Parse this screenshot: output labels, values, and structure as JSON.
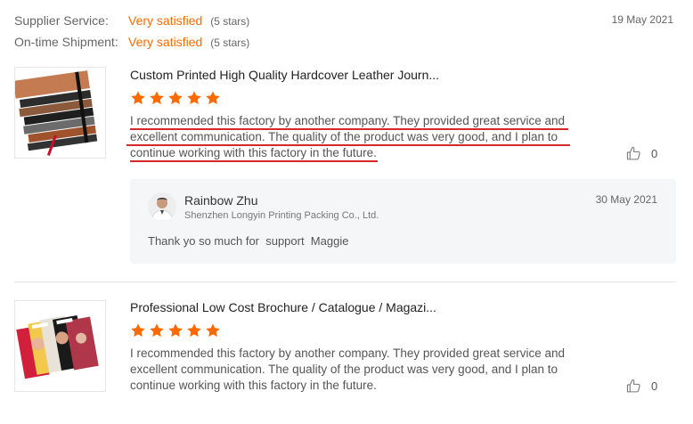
{
  "ratings": {
    "supplier_service": {
      "label": "Supplier Service:",
      "value": "Very satisfied",
      "stars_note": "(5 stars)"
    },
    "on_time_shipment": {
      "label": "On-time Shipment:",
      "value": "Very satisfied",
      "stars_note": "(5 stars)"
    },
    "date": "19 May 2021"
  },
  "reviews": [
    {
      "product_title": "Custom Printed High Quality Hardcover Leather Journ...",
      "rating": 5,
      "text_lines": [
        "I recommended this factory by another company. They provided great service and",
        "excellent communication. The quality of the product was very good, and I plan to",
        "continue working with this factory in the future."
      ],
      "likes": "0",
      "reply": {
        "name": "Rainbow Zhu",
        "company": "Shenzhen Longyin Printing Packing Co., Ltd.",
        "date": "30 May 2021",
        "text": "Thank yo so much for  support  Maggie"
      }
    },
    {
      "product_title": "Professional Low Cost Brochure / Catalogue / Magazi...",
      "rating": 5,
      "text_lines": [
        "I recommended this factory by another company. They provided great service and",
        "excellent communication. The quality of the product was very good, and I plan to",
        "continue working with this factory in the future."
      ],
      "likes": "0"
    }
  ],
  "colors": {
    "accent": "#ff6a00",
    "underline": "#d62828",
    "reply_bg": "#f5f6f8"
  },
  "icons": {
    "star": "star-icon",
    "like": "thumbs-up-icon"
  }
}
